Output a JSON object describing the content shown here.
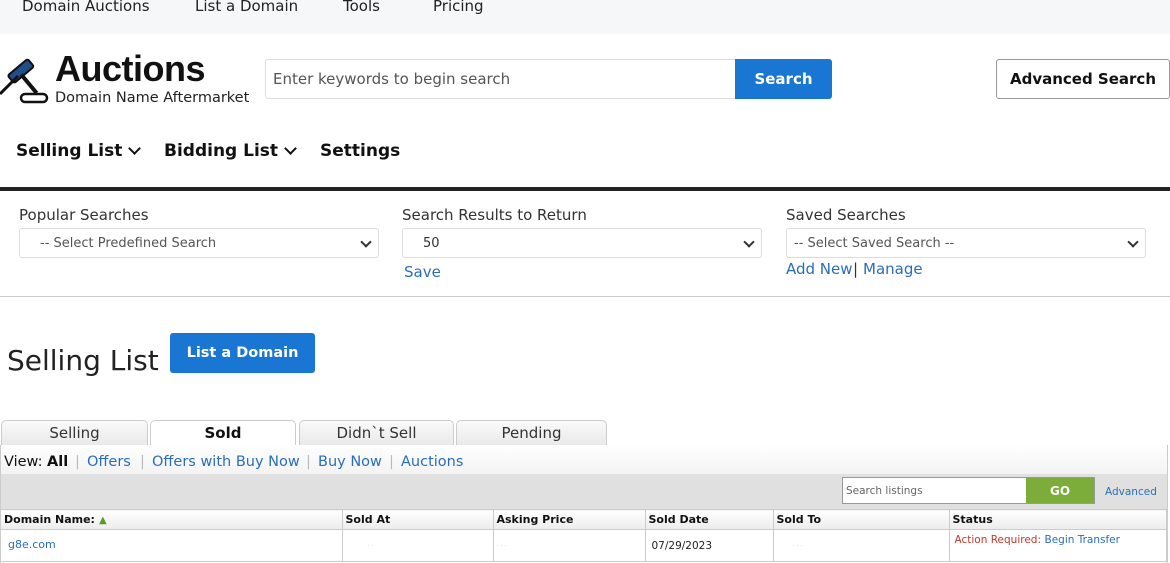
{
  "top_nav": [
    "Domain Auctions",
    "List a Domain",
    "Tools",
    "Pricing"
  ],
  "logo": {
    "title": "Auctions",
    "subtitle": "Domain Name Aftermarket",
    "icon": "gavel-icon"
  },
  "search": {
    "placeholder": "Enter keywords to begin search",
    "button": "Search",
    "advanced": "Advanced Search"
  },
  "sub_nav": {
    "selling": "Selling List",
    "bidding": "Bidding List",
    "settings": "Settings"
  },
  "filters": {
    "popular": {
      "label": "Popular Searches",
      "selected": "-- Select Predefined Search"
    },
    "results": {
      "label": "Search Results to Return",
      "selected": "50",
      "save": "Save"
    },
    "saved": {
      "label": "Saved Searches",
      "selected": "-- Select Saved Search --",
      "add_new": "Add New",
      "separator": "|",
      "manage": "Manage"
    }
  },
  "page": {
    "title": "Selling List",
    "list_button": "List a Domain"
  },
  "tabs": [
    "Selling",
    "Sold",
    "Didn`t Sell",
    "Pending"
  ],
  "active_tab": "Sold",
  "view": {
    "label": "View:",
    "options": [
      "All",
      "Offers",
      "Offers with Buy Now",
      "Buy Now",
      "Auctions"
    ],
    "separator": "|"
  },
  "listing_search": {
    "placeholder": "Search listings",
    "go": "GO",
    "advanced": "Advanced"
  },
  "table": {
    "columns": [
      "Domain Name:",
      "Sold At",
      "Asking Price",
      "Sold Date",
      "Sold To",
      "Status"
    ],
    "rows": [
      {
        "domain": "g8e.com",
        "sold_at": "· ·",
        "asking_price": "· · ·",
        "sold_date": "07/29/2023",
        "sold_to": "· · ·",
        "status_prefix": "Action Required:",
        "status_link": "Begin Transfer"
      }
    ]
  },
  "colors": {
    "primary_blue": "#1976d2",
    "link": "#2a6ebb",
    "go_green": "#7cad3a",
    "alert_red": "#c0392b"
  }
}
